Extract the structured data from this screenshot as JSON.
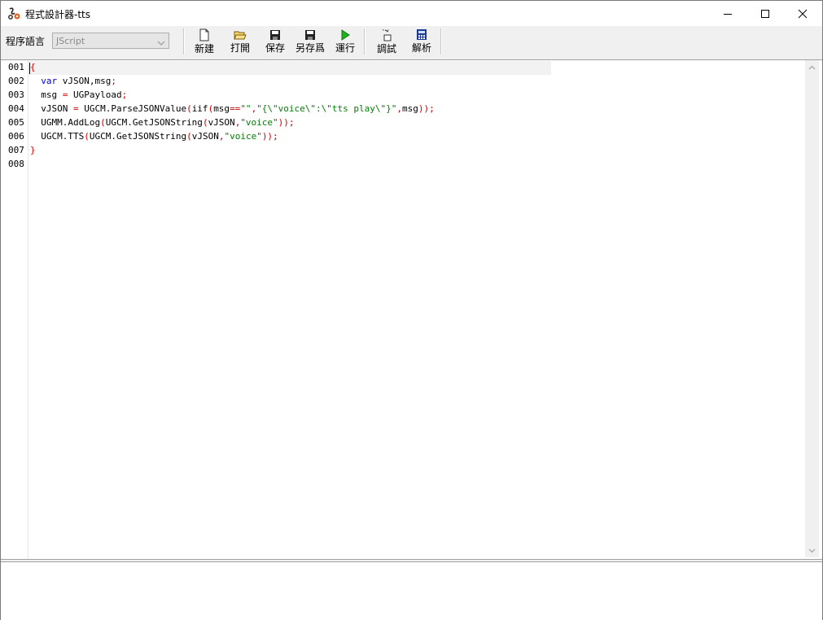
{
  "window": {
    "title": "程式設計器-tts",
    "controls": {
      "minimize": "minimize",
      "maximize": "maximize",
      "close": "close"
    }
  },
  "toolbar": {
    "language_label": "程序語言",
    "language_value": "JScript",
    "buttons": [
      {
        "label": "新建",
        "icon": "new-file-icon"
      },
      {
        "label": "打開",
        "icon": "open-folder-icon"
      },
      {
        "label": "保存",
        "icon": "save-icon"
      },
      {
        "label": "另存爲",
        "icon": "save-as-icon"
      },
      {
        "label": "運行",
        "icon": "run-icon"
      },
      {
        "label": "調試",
        "icon": "debug-icon"
      },
      {
        "label": "解析",
        "icon": "calculator-icon"
      }
    ]
  },
  "editor": {
    "line_numbers": [
      "001",
      "002",
      "003",
      "004",
      "005",
      "006",
      "007",
      "008"
    ],
    "lines": [
      [
        {
          "t": "{",
          "c": "red"
        }
      ],
      [
        {
          "t": "  ",
          "c": "blk"
        },
        {
          "t": "var",
          "c": "blue"
        },
        {
          "t": " vJSON,msg",
          "c": "blk"
        },
        {
          "t": ";",
          "c": "red"
        }
      ],
      [
        {
          "t": "  msg ",
          "c": "blk"
        },
        {
          "t": "=",
          "c": "red"
        },
        {
          "t": " UGPayload",
          "c": "blk"
        },
        {
          "t": ";",
          "c": "red"
        }
      ],
      [
        {
          "t": "  vJSON ",
          "c": "blk"
        },
        {
          "t": "=",
          "c": "red"
        },
        {
          "t": " UGCM.ParseJSONValue",
          "c": "blk"
        },
        {
          "t": "(",
          "c": "red"
        },
        {
          "t": "iif",
          "c": "blk"
        },
        {
          "t": "(",
          "c": "red"
        },
        {
          "t": "msg",
          "c": "blk"
        },
        {
          "t": "==",
          "c": "red"
        },
        {
          "t": "\"\"",
          "c": "green"
        },
        {
          "t": ",",
          "c": "red"
        },
        {
          "t": "\"{\\\"voice\\\":\\\"tts play\\\"}\"",
          "c": "green"
        },
        {
          "t": ",",
          "c": "red"
        },
        {
          "t": "msg",
          "c": "blk"
        },
        {
          "t": "));",
          "c": "red"
        }
      ],
      [
        {
          "t": "  UGMM.AddLog",
          "c": "blk"
        },
        {
          "t": "(",
          "c": "red"
        },
        {
          "t": "UGCM.GetJSONString",
          "c": "blk"
        },
        {
          "t": "(",
          "c": "red"
        },
        {
          "t": "vJSON",
          "c": "blk"
        },
        {
          "t": ",",
          "c": "red"
        },
        {
          "t": "\"voice\"",
          "c": "green"
        },
        {
          "t": "));",
          "c": "red"
        }
      ],
      [
        {
          "t": "  UGCM.TTS",
          "c": "blk"
        },
        {
          "t": "(",
          "c": "red"
        },
        {
          "t": "UGCM.GetJSONString",
          "c": "blk"
        },
        {
          "t": "(",
          "c": "red"
        },
        {
          "t": "vJSON",
          "c": "blk"
        },
        {
          "t": ",",
          "c": "red"
        },
        {
          "t": "\"voice\"",
          "c": "green"
        },
        {
          "t": "));",
          "c": "red"
        }
      ],
      [
        {
          "t": "}",
          "c": "red"
        }
      ],
      []
    ]
  },
  "output": {
    "text": ""
  }
}
